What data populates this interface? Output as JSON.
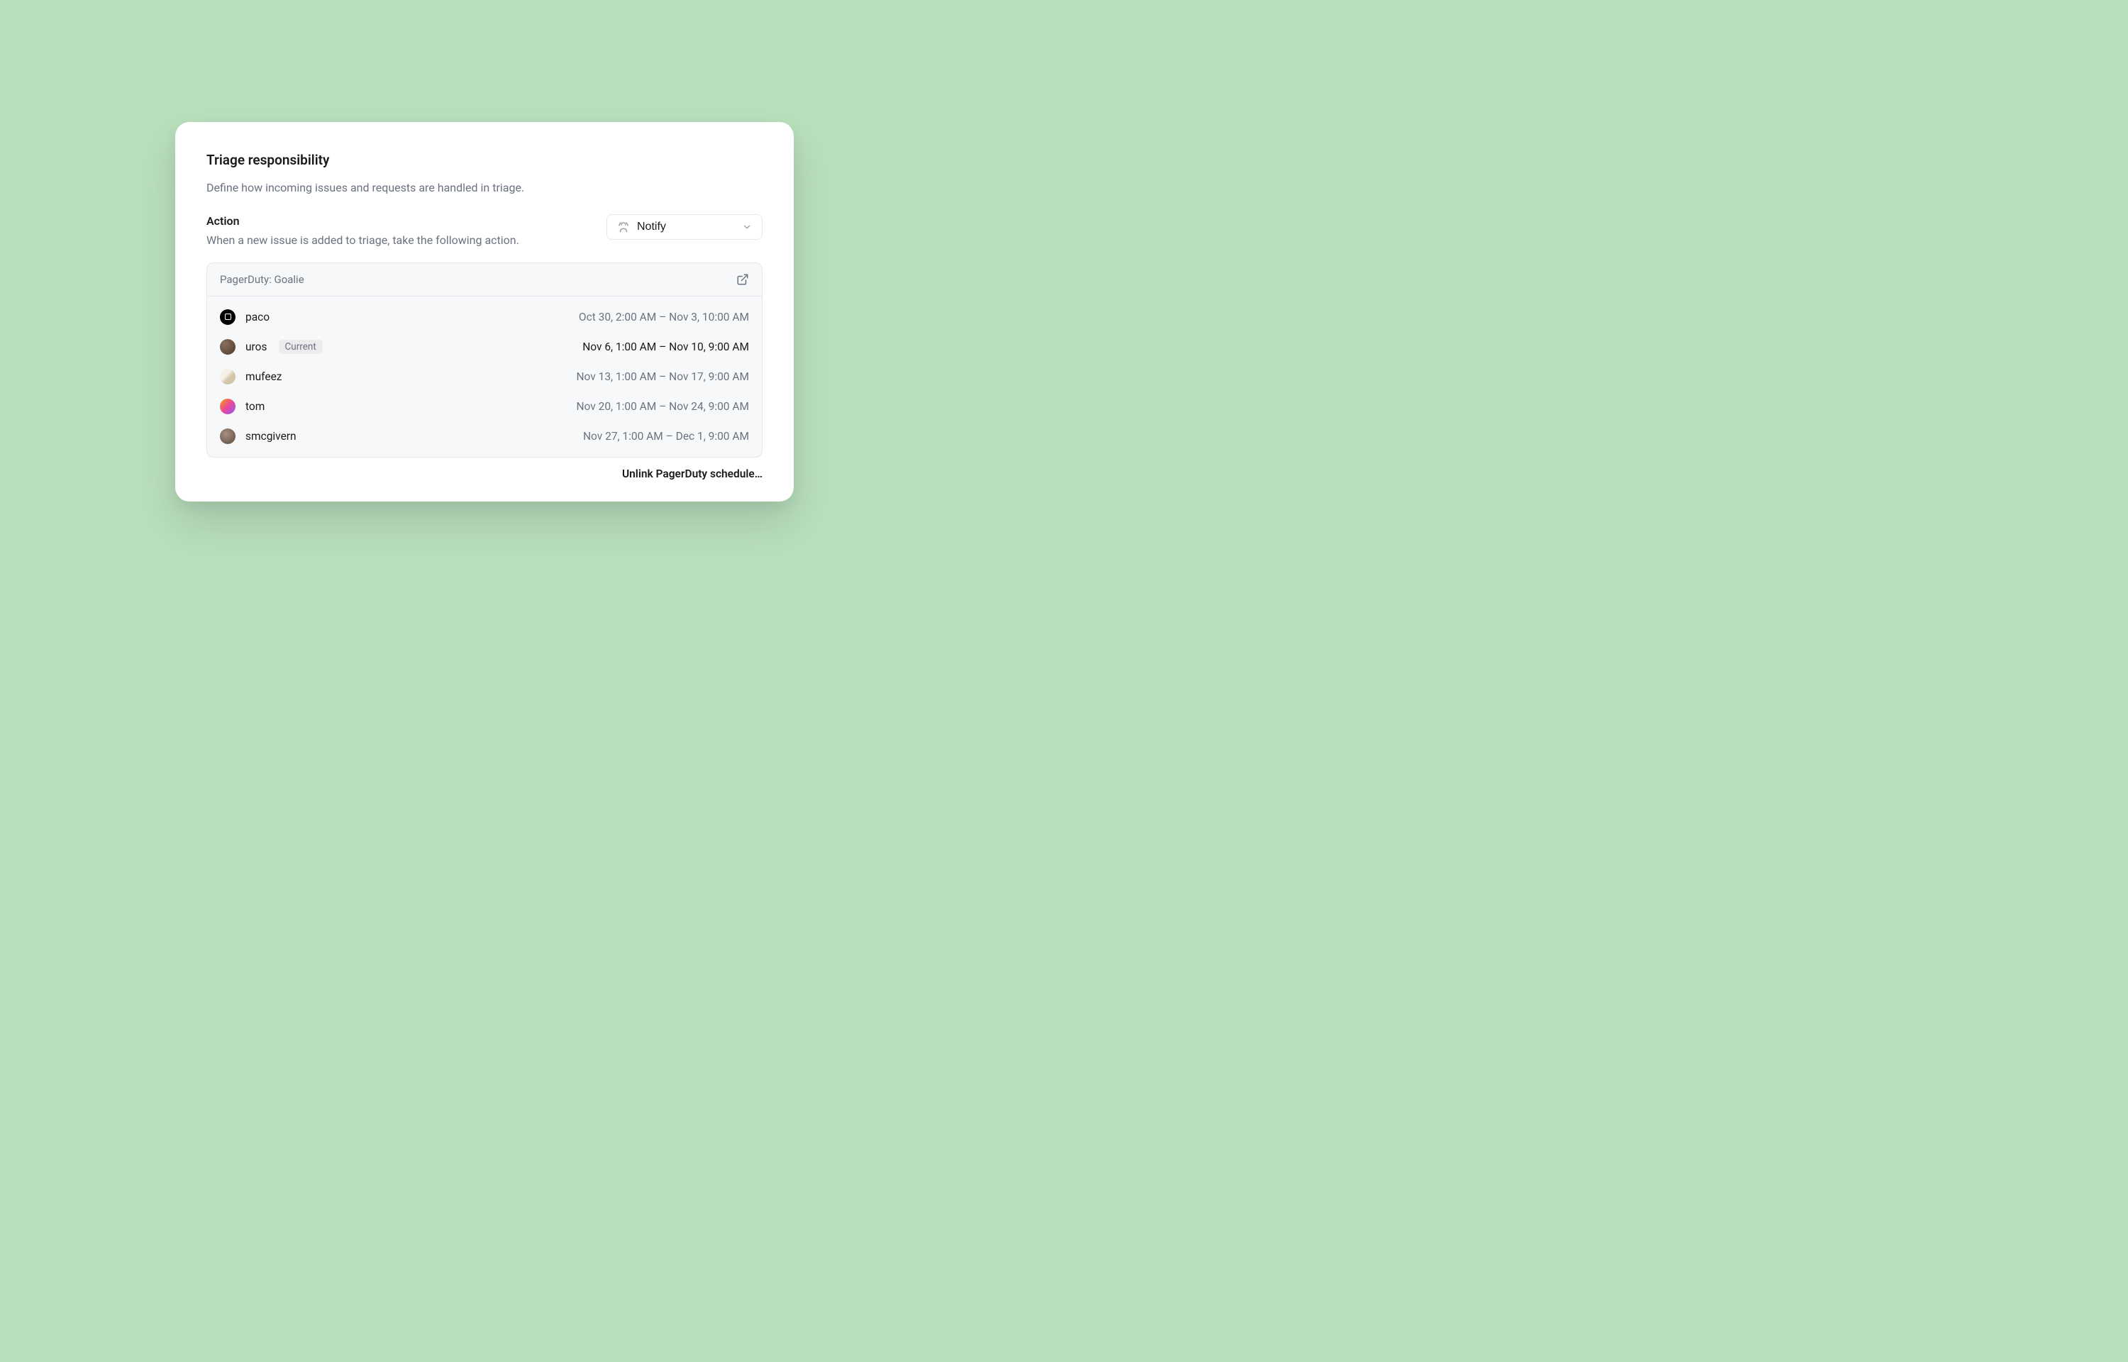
{
  "header": {
    "title": "Triage responsibility",
    "subtitle": "Define how incoming issues and requests are handled in triage."
  },
  "action": {
    "heading": "Action",
    "description": "When a new issue is added to triage, take the following action.",
    "selected_label": "Notify"
  },
  "schedule": {
    "title": "PagerDuty: Goalie",
    "rows": [
      {
        "name": "paco",
        "badge": null,
        "range": "Oct 30, 2:00 AM – Nov 3, 10:00 AM",
        "current": false,
        "avatarClass": "av-black"
      },
      {
        "name": "uros",
        "badge": "Current",
        "range": "Nov 6, 1:00 AM – Nov 10, 9:00 AM",
        "current": true,
        "avatarClass": "av-photo1"
      },
      {
        "name": "mufeez",
        "badge": null,
        "range": "Nov 13, 1:00 AM – Nov 17, 9:00 AM",
        "current": false,
        "avatarClass": "av-photo2"
      },
      {
        "name": "tom",
        "badge": null,
        "range": "Nov 20, 1:00 AM – Nov 24, 9:00 AM",
        "current": false,
        "avatarClass": "av-gradient"
      },
      {
        "name": "smcgivern",
        "badge": null,
        "range": "Nov 27, 1:00 AM – Dec 1, 9:00 AM",
        "current": false,
        "avatarClass": "av-photo3"
      }
    ]
  },
  "footer": {
    "unlink_label": "Unlink PagerDuty schedule…"
  }
}
